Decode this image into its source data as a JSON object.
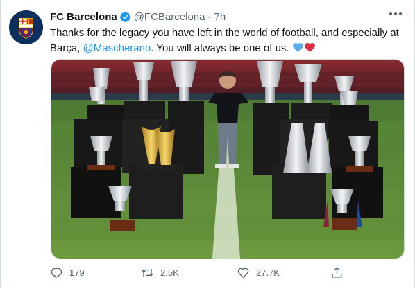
{
  "tweet": {
    "author_name": "FC Barcelona",
    "handle": "@FCBarcelona",
    "separator": "·",
    "time": "7h",
    "text_part1": "Thanks for the legacy you have left in the world of football, and especially at Barça, ",
    "mention": "@Mascherano",
    "text_part2": ". You will always be one of us. ",
    "emojis": [
      "blue-heart",
      "red-heart"
    ]
  },
  "avatar": {
    "logo_text": "FCB",
    "colors": {
      "blue": "#0c2f5e",
      "garnet": "#a50044",
      "gold": "#edbb00"
    }
  },
  "actions": {
    "reply_count": "179",
    "retweet_count": "2.5K",
    "like_count": "27.7K"
  },
  "colors": {
    "accent": "#1d9bf0",
    "muted": "#536471",
    "text": "#0f1419"
  }
}
